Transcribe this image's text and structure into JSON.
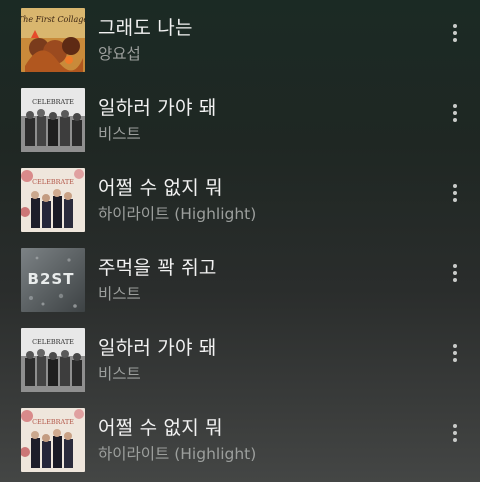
{
  "songs": [
    {
      "title": "그래도 나는",
      "artist": "양요섭",
      "art": "first-collage"
    },
    {
      "title": "일하러 가야 돼",
      "artist": "비스트",
      "art": "celebrate-bw"
    },
    {
      "title": "어쩔 수 없지 뭐",
      "artist": "하이라이트 (Highlight)",
      "art": "celebrate-floral"
    },
    {
      "title": "주먹을 꽉 쥐고",
      "artist": "비스트",
      "art": "beast-rain"
    },
    {
      "title": "일하러 가야 돼",
      "artist": "비스트",
      "art": "celebrate-bw"
    },
    {
      "title": "어쩔 수 없지 뭐",
      "artist": "하이라이트 (Highlight)",
      "art": "celebrate-floral"
    }
  ],
  "art_text": {
    "first_collage": "The First Collage",
    "celebrate": "CELEBRATE",
    "beast": "B2ST"
  },
  "icons": {
    "more": "more-vertical-icon"
  }
}
